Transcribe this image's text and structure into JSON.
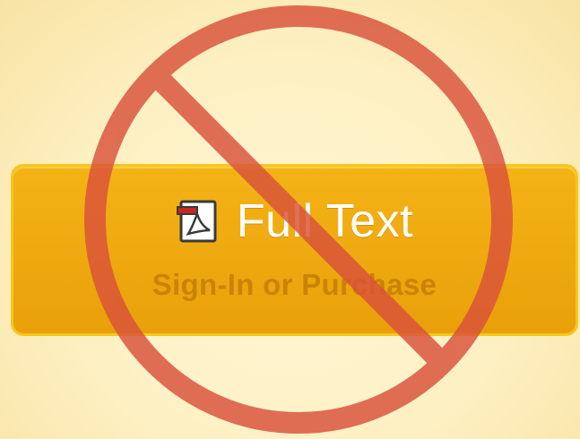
{
  "button": {
    "title": "Full Text",
    "subtitle": "Sign-In or Purchase",
    "icon": "pdf-file-icon"
  },
  "overlay": {
    "icon": "prohibition-icon",
    "color": "#d9513a"
  },
  "colors": {
    "background": "#fdf0c2",
    "button_fill": "#eea90f",
    "button_border": "#f6c71a",
    "title_text": "#ffffff",
    "subtitle_text": "#c98306"
  }
}
